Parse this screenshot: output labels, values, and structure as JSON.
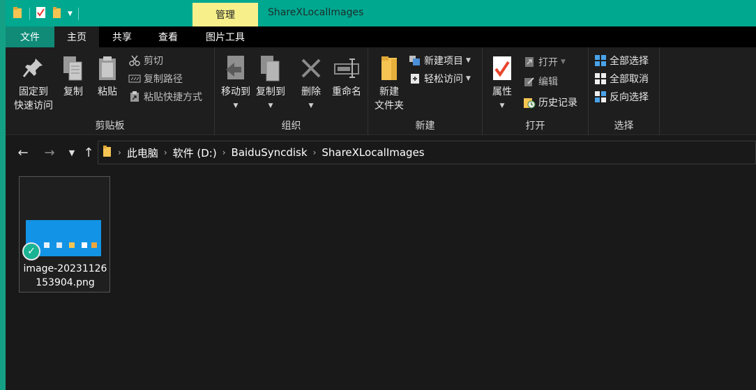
{
  "window": {
    "title": "ShareXLocalImages",
    "context_tab": "管理"
  },
  "tabs": [
    {
      "label": "文件"
    },
    {
      "label": "主页"
    },
    {
      "label": "共享"
    },
    {
      "label": "查看"
    },
    {
      "label": "图片工具"
    }
  ],
  "ribbon": {
    "clipboard": {
      "label": "剪贴板",
      "pin_line1": "固定到",
      "pin_line2": "快速访问",
      "copy": "复制",
      "paste": "粘贴",
      "cut": "剪切",
      "copy_path": "复制路径",
      "paste_shortcut": "粘贴快捷方式"
    },
    "organize": {
      "label": "组织",
      "move_to": "移动到",
      "copy_to": "复制到",
      "delete": "删除",
      "rename": "重命名"
    },
    "new": {
      "label": "新建",
      "new_folder_line1": "新建",
      "new_folder_line2": "文件夹",
      "new_item": "新建项目",
      "easy_access": "轻松访问"
    },
    "open": {
      "label": "打开",
      "properties": "属性",
      "open": "打开",
      "edit": "编辑",
      "history": "历史记录"
    },
    "select": {
      "label": "选择",
      "select_all": "全部选择",
      "select_none": "全部取消",
      "invert": "反向选择"
    }
  },
  "address": {
    "crumbs": [
      "此电脑",
      "软件 (D:)",
      "BaiduSyncdisk",
      "ShareXLocalImages"
    ]
  },
  "files": [
    {
      "name": "image-20231126153904.png"
    }
  ],
  "colors": {
    "titlebar": "#00a890",
    "manage_tab": "#f7f08a",
    "file_tab": "#0f8b78",
    "sync_check": "#19b393",
    "thumb": "#1293e6"
  }
}
